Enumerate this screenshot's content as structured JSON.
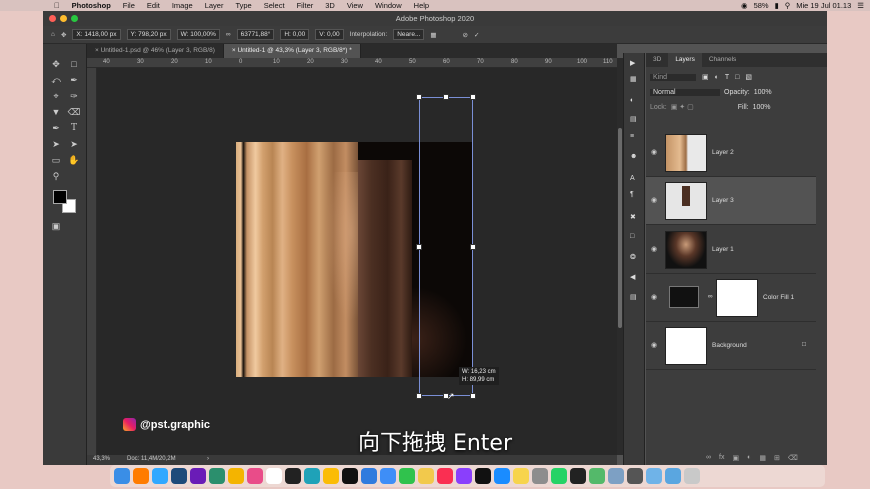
{
  "menubar": {
    "app": "Photoshop",
    "items": [
      "File",
      "Edit",
      "Image",
      "Layer",
      "Type",
      "Select",
      "Filter",
      "3D",
      "View",
      "Window",
      "Help"
    ],
    "battery": "58%",
    "datetime": "Mie 19 Jul 01.13"
  },
  "window": {
    "title": "Adobe Photoshop 2020"
  },
  "options": {
    "x": "X: 1418,00 px",
    "y": "Y: 798,20 px",
    "w": "W: 100,00%",
    "link": "∞",
    "angle": "63771,88°",
    "h": "H: 0,00",
    "v": "V: 0,00",
    "interp_label": "Interpolation:",
    "interp_value": "Neare..."
  },
  "doc_tabs": [
    {
      "label": "Untitled-1.psd @ 46% (Layer 3, RGB/8)"
    },
    {
      "label": "Untitled-1 @ 43,3% (Layer 3, RGB/8*) *"
    }
  ],
  "ruler_ticks": [
    "40",
    "30",
    "20",
    "10",
    "0",
    "10",
    "20",
    "30",
    "40",
    "50",
    "60",
    "70",
    "80",
    "90",
    "100",
    "110"
  ],
  "transform_readout": {
    "w": "W: 16,23 cm",
    "h": "H: 89,99 cm"
  },
  "status": {
    "zoom": "43,3%",
    "doc": "Doc: 11,4M/20,2M"
  },
  "panel": {
    "tabs": [
      "3D",
      "Layers",
      "Channels"
    ],
    "filter": "Kind",
    "blend_mode": "Normal",
    "opacity_label": "Opacity:",
    "opacity": "100%",
    "lock_label": "Lock:",
    "fill_label": "Fill:",
    "fill": "100%"
  },
  "layers": [
    {
      "name": "Layer 2"
    },
    {
      "name": "Layer 3"
    },
    {
      "name": "Layer 1"
    },
    {
      "name": "Color Fill 1"
    },
    {
      "name": "Background"
    }
  ],
  "overlay": {
    "handle": "@pst.graphic",
    "subtitle": "向下拖拽 Enter"
  }
}
